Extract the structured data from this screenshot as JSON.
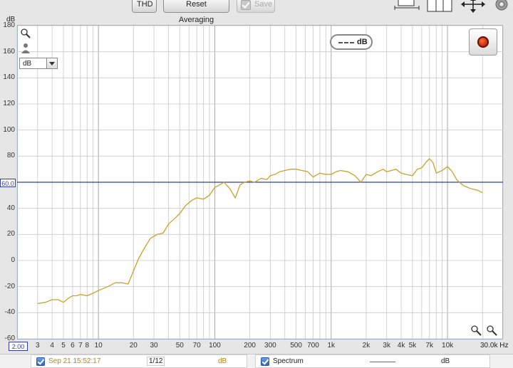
{
  "toolbar": {
    "thd_label": "THD",
    "reset_label": "Reset Averaging",
    "save_label": "Save"
  },
  "controls": {
    "unit_select_value": "dB",
    "legend_label": "dB",
    "ref_level": "60.0",
    "x_min": "2.00"
  },
  "bottom": {
    "trace1_label": "Sep 21 15:52:17",
    "trace1_smoothing": "1/12",
    "trace1_unit": "dB",
    "trace2_label": "Spectrum",
    "trace2_unit": "dB"
  },
  "colors": {
    "trace": "#c8a22a",
    "reference_line": "#3340a0",
    "grid": "#c8c8c8"
  },
  "chart_data": {
    "type": "line",
    "title": "",
    "xlabel": "",
    "ylabel": "dB",
    "x_scale": "log",
    "xlim": [
      2,
      30000
    ],
    "ylim": [
      -60,
      180
    ],
    "y_ticks": [
      "180",
      "160",
      "140",
      "120",
      "100",
      "80",
      "60",
      "40",
      "20",
      "0",
      "-20",
      "-40",
      "-60"
    ],
    "y_tick_values": [
      180,
      160,
      140,
      120,
      100,
      80,
      60,
      40,
      20,
      0,
      -20,
      -40,
      -60
    ],
    "x_ticks": [
      {
        "label": "3",
        "value": 3
      },
      {
        "label": "4",
        "value": 4
      },
      {
        "label": "5",
        "value": 5
      },
      {
        "label": "6",
        "value": 6
      },
      {
        "label": "7",
        "value": 7
      },
      {
        "label": "8",
        "value": 8
      },
      {
        "label": "10",
        "value": 10
      },
      {
        "label": "20",
        "value": 20
      },
      {
        "label": "30",
        "value": 30
      },
      {
        "label": "50",
        "value": 50
      },
      {
        "label": "70",
        "value": 70
      },
      {
        "label": "100",
        "value": 100
      },
      {
        "label": "200",
        "value": 200
      },
      {
        "label": "300",
        "value": 300
      },
      {
        "label": "500",
        "value": 500
      },
      {
        "label": "700",
        "value": 700
      },
      {
        "label": "1k",
        "value": 1000
      },
      {
        "label": "2k",
        "value": 2000
      },
      {
        "label": "3k",
        "value": 3000
      },
      {
        "label": "4k",
        "value": 4000
      },
      {
        "label": "5k",
        "value": 5000
      },
      {
        "label": "7k",
        "value": 7000
      },
      {
        "label": "10k",
        "value": 10000
      }
    ],
    "x_unit_label": "30.0k Hz",
    "reference_line_db": 60,
    "grid": true,
    "series": [
      {
        "x": [
          3,
          3.5,
          4,
          4.5,
          5,
          5.5,
          6,
          6.5,
          7,
          8,
          9,
          10,
          12,
          14,
          16,
          18,
          20,
          22,
          25,
          28,
          32,
          36,
          40,
          45,
          50,
          56,
          63,
          70,
          80,
          90,
          100,
          110,
          120,
          135,
          150,
          165,
          180,
          200,
          220,
          250,
          280,
          300,
          330,
          360,
          400,
          450,
          500,
          560,
          630,
          700,
          800,
          900,
          1000,
          1100,
          1200,
          1400,
          1600,
          1800,
          2000,
          2200,
          2500,
          2800,
          3000,
          3300,
          3600,
          4000,
          4400,
          5000,
          5500,
          6000,
          6500,
          7000,
          7500,
          8000,
          9000,
          10000,
          11000,
          12000,
          13000,
          14000,
          16000,
          18000,
          20000
        ],
        "y": [
          -33,
          -32,
          -30,
          -30,
          -32,
          -29,
          -27,
          -27,
          -26,
          -27,
          -25,
          -23,
          -20,
          -17,
          -17,
          -18,
          -8,
          1,
          10,
          17,
          20,
          21,
          28,
          32,
          36,
          42,
          46,
          48,
          47,
          50,
          56,
          58,
          60,
          55,
          48,
          58,
          60,
          61,
          60,
          63,
          62,
          65,
          66,
          68,
          69,
          70,
          70,
          69,
          68,
          64,
          67,
          66,
          66,
          68,
          69,
          68,
          65,
          60,
          66,
          65,
          68,
          70,
          68,
          69,
          70,
          67,
          66,
          65,
          70,
          71,
          75,
          78,
          75,
          67,
          69,
          72,
          68,
          62,
          59,
          57,
          55,
          54,
          52
        ]
      }
    ]
  }
}
